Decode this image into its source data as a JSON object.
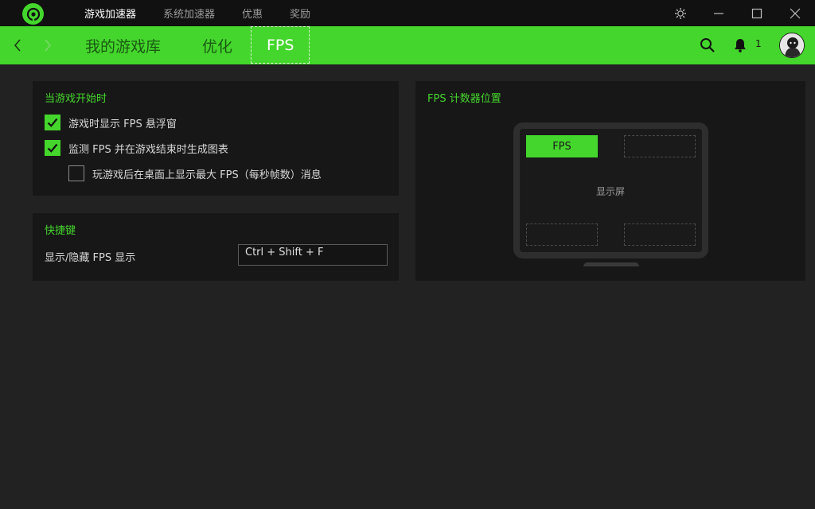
{
  "titlebar": {
    "nav": [
      {
        "label": "游戏加速器",
        "active": true
      },
      {
        "label": "系统加速器",
        "active": false
      },
      {
        "label": "优惠",
        "active": false
      },
      {
        "label": "奖励",
        "active": false
      }
    ]
  },
  "subnav": {
    "tabs": [
      {
        "label": "我的游戏库",
        "active": false
      },
      {
        "label": "优化",
        "active": false
      },
      {
        "label": "FPS",
        "active": true
      }
    ],
    "notification_count": "1"
  },
  "game_start_panel": {
    "title": "当游戏开始时",
    "options": [
      {
        "label": "游戏时显示 FPS 悬浮窗",
        "checked": true
      },
      {
        "label": "监测 FPS 并在游戏结束时生成图表",
        "checked": true
      },
      {
        "label": "玩游戏后在桌面上显示最大 FPS（每秒帧数）消息",
        "checked": false
      }
    ]
  },
  "hotkey_panel": {
    "title": "快捷键",
    "label": "显示/隐藏 FPS 显示",
    "value": "Ctrl + Shift + F"
  },
  "fps_position_panel": {
    "title": "FPS 计数器位置",
    "active_slot_label": "FPS",
    "screen_label": "显示屏"
  },
  "colors": {
    "accent": "#44d62c",
    "background": "#222222",
    "panel": "#171717",
    "titlebar": "#111111"
  }
}
